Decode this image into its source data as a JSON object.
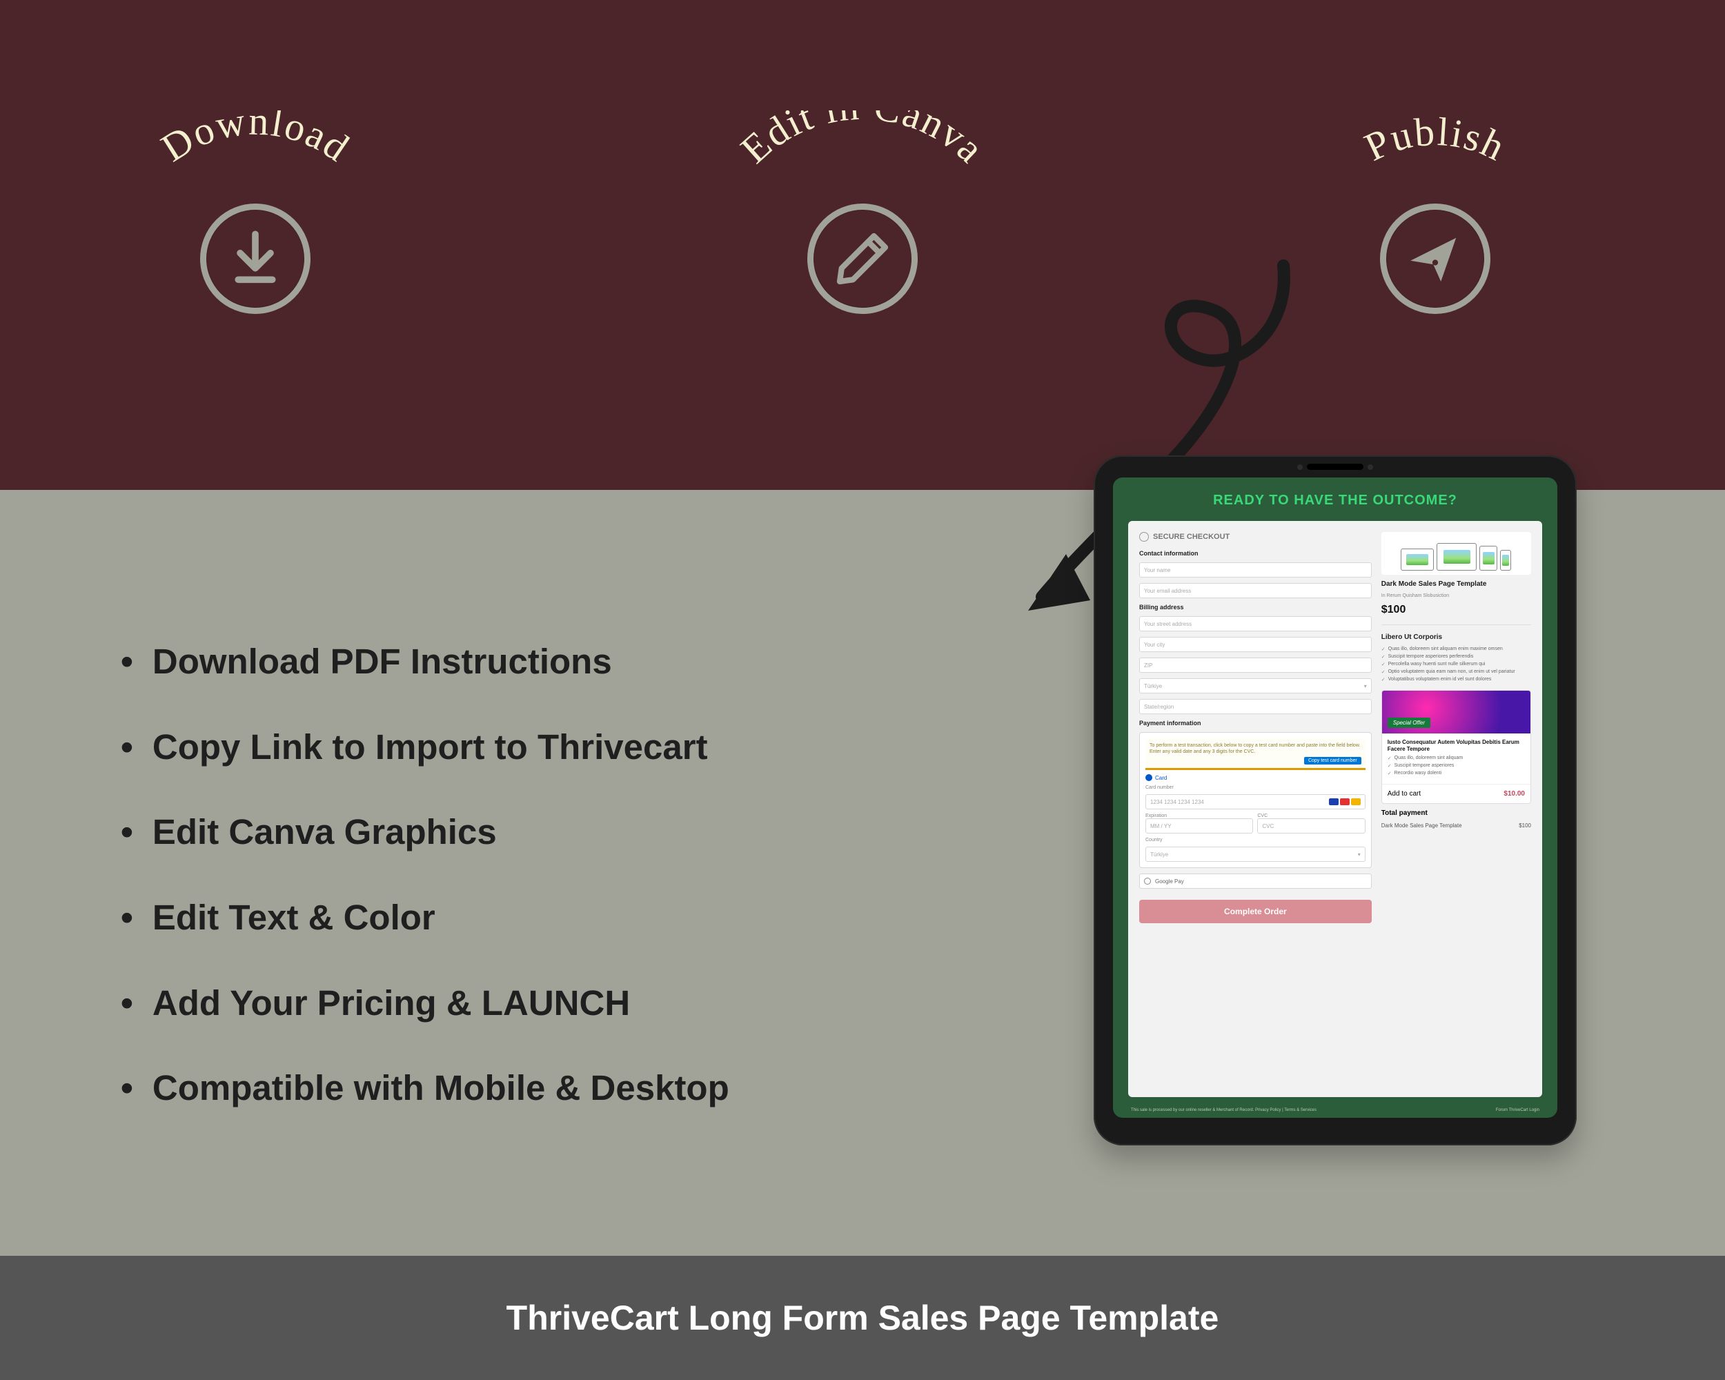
{
  "colors": {
    "maroon": "#4b2529",
    "sage": "#a1a398",
    "cream": "#f4efce",
    "footer": "#555555",
    "ring": "#a1a398",
    "screen_green": "#2b5d3a"
  },
  "steps": {
    "download": {
      "label": "Download",
      "icon": "download-icon"
    },
    "edit": {
      "label": "Edit in Canva",
      "icon": "pencil-icon"
    },
    "publish": {
      "label": "Publish",
      "icon": "send-icon"
    }
  },
  "bullets": [
    "Download PDF Instructions",
    "Copy Link to Import to Thrivecart",
    "Edit Canva Graphics",
    "Edit Text & Color",
    "Add Your Pricing & LAUNCH",
    "Compatible with Mobile & Desktop"
  ],
  "footer": "ThriveCart Long Form Sales Page Template",
  "tablet": {
    "headline": "READY TO HAVE THE OUTCOME?",
    "secure_label": "SECURE CHECKOUT",
    "left": {
      "contact_h": "Contact information",
      "contact_fields": [
        "Your name",
        "Your email address"
      ],
      "billing_h": "Billing address",
      "billing_fields": [
        "Your street address",
        "Your city",
        "ZIP",
        "Türkiye",
        "State/region"
      ],
      "payment_h": "Payment information",
      "payment_note": "To perform a test transaction, click below to copy a test card number and paste into the field below. Enter any valid date and any 3 digits for the CVC.",
      "copy_btn": "Copy test card number",
      "card_tab": "Card",
      "card_label": "Card number",
      "card_ph": "1234 1234 1234 1234",
      "exp_label": "Expiration",
      "exp_ph": "MM / YY",
      "cvc_label": "CVC",
      "cvc_ph": "CVC",
      "country_label": "Country",
      "country_val": "Türkiye",
      "gpay": "Google Pay",
      "cta": "Complete Order"
    },
    "right": {
      "product_name": "Dark Mode Sales Page Template",
      "product_sub": "In Rerum Quisham Slobusiction",
      "price": "$100",
      "benefits_h": "Libero Ut Corporis",
      "benefits": [
        "Quas illo, doloreem sint aliquam enim maxime omsen",
        "Suscipit tempore asperiores perferendis",
        "Percolella wasy huenti sunt nulle silkerum qui",
        "Optio voluptatem quia eam nam non, ut enim ut vel pariatur",
        "Voluptatibus voluptatem enim id vel sunt dolores"
      ],
      "offer_ribbon": "Special Offer",
      "offer_title": "Iusto Consequatur Autem Volupitas Debitis Earum Facere Tempore",
      "offer_points": [
        "Quas illo, doloreem sint aliquam",
        "Suscipit tempore asperiores",
        "Recordio wasy dolenti"
      ],
      "add_label": "Add to cart",
      "add_price": "$10.00",
      "total_h": "Total payment",
      "total_line_label": "Dark Mode Sales Page Template",
      "total_line_val": "$100"
    },
    "foot_left": "This sale is processed by our online reseller & Merchant of Record. Privacy Policy  |  Terms & Services",
    "foot_right": "Forum  ThriveCart  Login"
  }
}
